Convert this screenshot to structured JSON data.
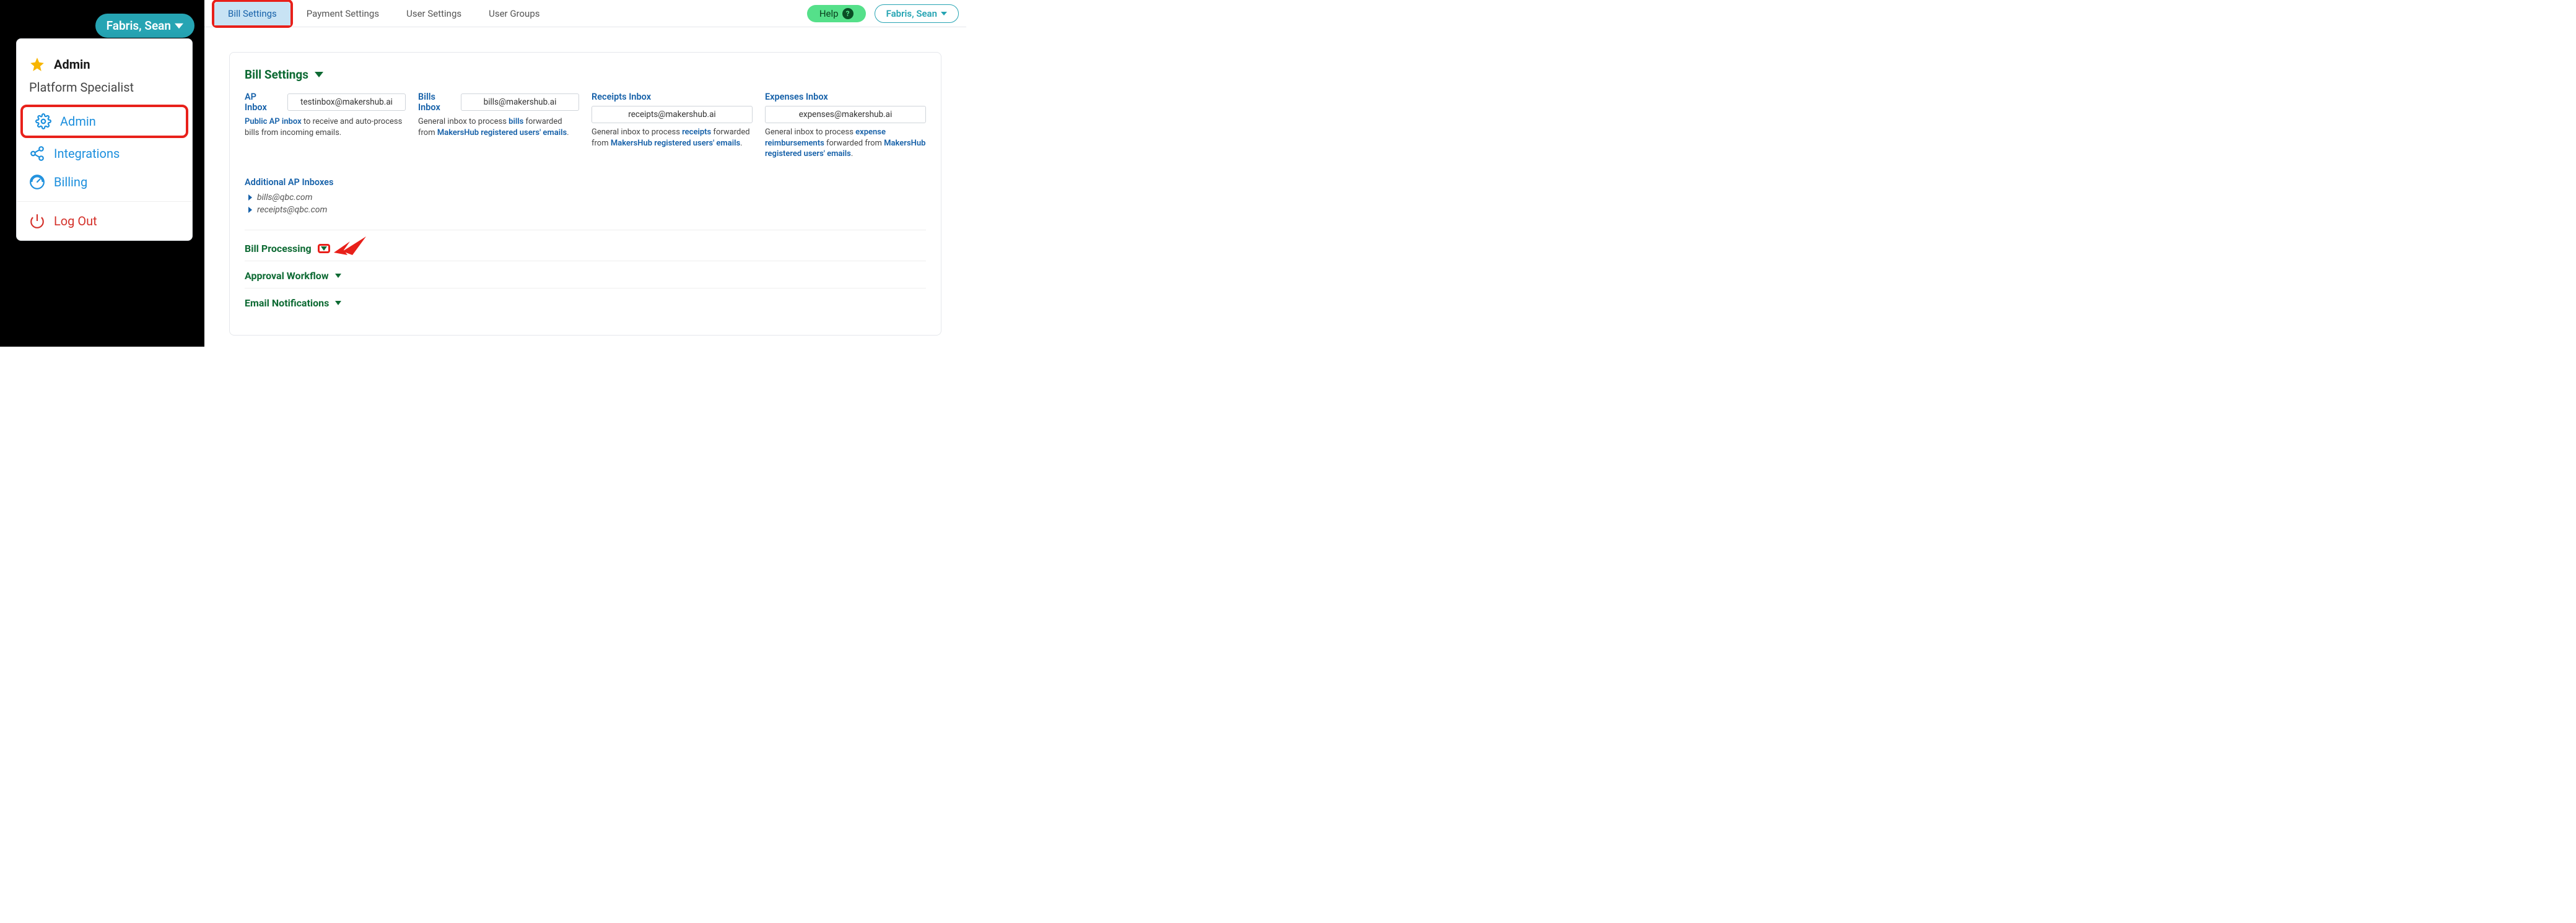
{
  "header": {
    "user_label": "Fabris, Sean",
    "help_label": "Help"
  },
  "dropdown": {
    "admin_title": "Admin",
    "subtitle": "Platform Specialist",
    "items": {
      "admin": "Admin",
      "integrations": "Integrations",
      "billing": "Billing",
      "logout": "Log Out"
    }
  },
  "tabs": {
    "bill": "Bill Settings",
    "payment": "Payment Settings",
    "user": "User Settings",
    "groups": "User Groups"
  },
  "bill_settings": {
    "title": "Bill Settings",
    "ap_inbox": {
      "label": "AP Inbox",
      "value": "testinbox@makershub.ai",
      "desc_pre": "Public AP inbox",
      "desc_post": " to receive and auto-process bills from incoming emails."
    },
    "bills_inbox": {
      "label": "Bills Inbox",
      "value": "bills@makershub.ai",
      "desc_pre": "General inbox to process ",
      "desc_mid": "bills",
      "desc_post": " forwarded from ",
      "desc_tail": "MakersHub registered users' emails",
      "desc_end": "."
    },
    "receipts_inbox": {
      "label": "Receipts Inbox",
      "value": "receipts@makershub.ai",
      "desc_pre": "General inbox to process ",
      "desc_mid": "receipts",
      "desc_post": " forwarded from ",
      "desc_tail": "MakersHub registered users' emails",
      "desc_end": "."
    },
    "expenses_inbox": {
      "label": "Expenses Inbox",
      "value": "expenses@makershub.ai",
      "desc_pre": "General inbox to process ",
      "desc_mid": "expense reimbursements",
      "desc_post": " forwarded from ",
      "desc_tail": "MakersHub registered users' emails",
      "desc_end": "."
    },
    "additional_label": "Additional AP Inboxes",
    "additional_items": [
      "bills@qbc.com",
      "receipts@qbc.com"
    ],
    "bill_processing": "Bill Processing",
    "approval_workflow": "Approval Workflow",
    "email_notifications": "Email Notifications"
  }
}
